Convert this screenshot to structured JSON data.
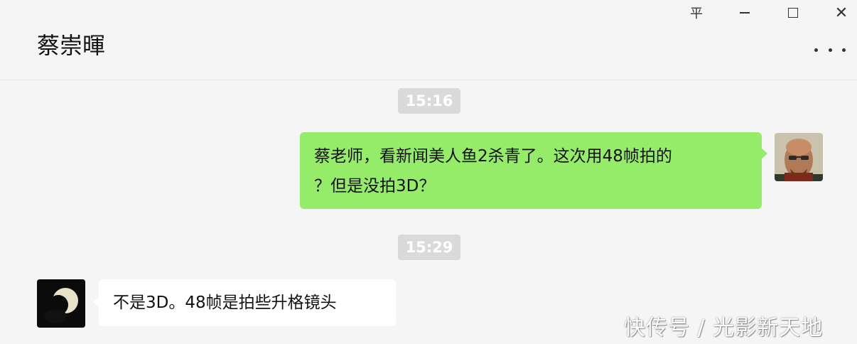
{
  "window": {
    "title": "蔡崇暉",
    "controls": {
      "pin_icon": "pin-icon",
      "minimize_icon": "minimize-icon",
      "maximize_icon": "maximize-icon",
      "close_icon": "close-icon",
      "more_icon": "more-icon"
    },
    "pin_glyph": "平",
    "close_glyph": "✕"
  },
  "messages": [
    {
      "type": "timestamp",
      "text": "15:16"
    },
    {
      "type": "outgoing",
      "text_line1": "蔡老师，看新闻美人鱼2杀青了。这次用48帧拍的",
      "text_line2": "？但是没拍3D？",
      "bubble_color": "#95ec69"
    },
    {
      "type": "timestamp",
      "text": "15:29"
    },
    {
      "type": "incoming",
      "text": "不是3D。48帧是拍些升格镜头",
      "bubble_color": "#ffffff"
    }
  ],
  "watermark": "快传号 / 光影新天地"
}
